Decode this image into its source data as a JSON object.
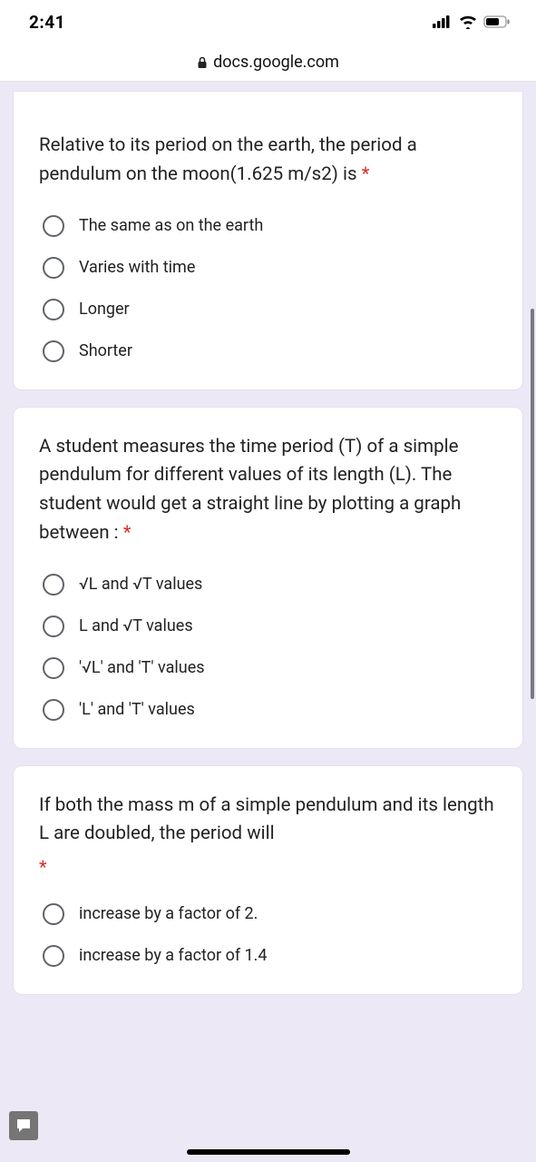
{
  "status": {
    "time": "2:41"
  },
  "url": "docs.google.com",
  "questions": [
    {
      "text": "Relative to its period on the earth, the period a pendulum on the moon(1.625 m/s2) is",
      "required": "*",
      "options": [
        "The same as on the earth",
        "Varies with time",
        "Longer",
        "Shorter"
      ]
    },
    {
      "text": "A student measures the time period (T) of a simple pendulum for different values of its length (L). The student would get a straight line by plotting a graph between :",
      "required": "*",
      "options": [
        "√L and √T values",
        "L and √T values",
        "'√L' and 'T' values",
        "'L' and 'T' values"
      ]
    },
    {
      "text": "If both the mass m of a simple pendulum and its length L are doubled, the period will",
      "required": "*",
      "options": [
        "increase by a factor of 2.",
        "increase by a factor of 1.4"
      ]
    }
  ]
}
